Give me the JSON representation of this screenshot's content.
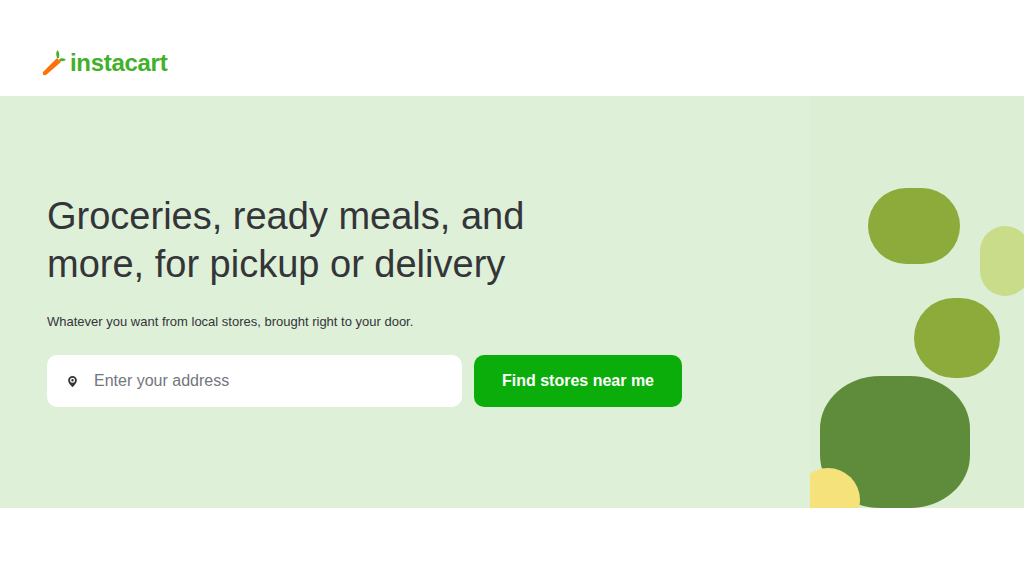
{
  "logo": {
    "text": "instacart"
  },
  "hero": {
    "heading_lines": [
      "Groceries, ready meals, and",
      "more, for pickup or delivery"
    ],
    "subheading": "Whatever you want from local stores, brought right to your door."
  },
  "address_field": {
    "placeholder": "Enter your address",
    "value": ""
  },
  "buttons": [
    "Find stores near me"
  ]
}
